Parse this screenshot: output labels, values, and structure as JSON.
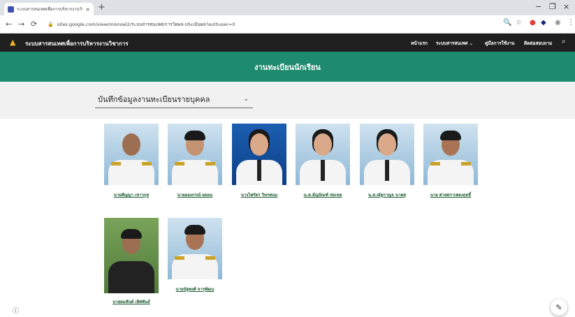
{
  "browser": {
    "tab_title": "ระบบสารสนเทศเพื่อการบริหารงานวิชา",
    "tab_close": "×",
    "new_tab": "+",
    "url": "sites.google.com/view/misnoel2/ระบบสารสนเทศ/การวัดผล-ประเมินผล?authuser=0",
    "window": {
      "minimize": "−",
      "restore": "❐",
      "close": "×"
    }
  },
  "site": {
    "title": "ระบบสารสนเทศเพื่อการบริหารงานวิชาการ",
    "menu": [
      "หน้าแรก",
      "ระบบสารสนเทศ ⌄",
      "คู่มือการใช้งาน",
      "ติดต่อสอบถาม"
    ]
  },
  "banner": {
    "title": "งานทะเบียนนักเรียน"
  },
  "dropdown": {
    "label": "บันทึกข้อมูลงานทะเบียนรายบุคคล",
    "chevron": "⌄"
  },
  "people": [
    {
      "name": "นายสัญญา เชาวกุล",
      "style": "uniform"
    },
    {
      "name": "นายอองกรณ์ ผลอน",
      "style": "uniform"
    },
    {
      "name": "นางไพรัตร วิทรพนม",
      "style": "female"
    },
    {
      "name": "น.ส.อัญบัณฑ์ ช่อเขย",
      "style": "female"
    },
    {
      "name": "น.ส.ณัฐกาญจ นาคสุ",
      "style": "female"
    },
    {
      "name": "นาย ศาสตราเพลงฤทธิ์",
      "style": "uniform"
    },
    {
      "name": "นายผมสันต์ เลิศพันธ์",
      "style": "casual"
    },
    {
      "name": "นายนัฐพงศ์ จารุพัฒน",
      "style": "uniform"
    }
  ],
  "icons": {
    "edit": "pencil-icon",
    "info": "info-icon",
    "search": "search-icon"
  }
}
